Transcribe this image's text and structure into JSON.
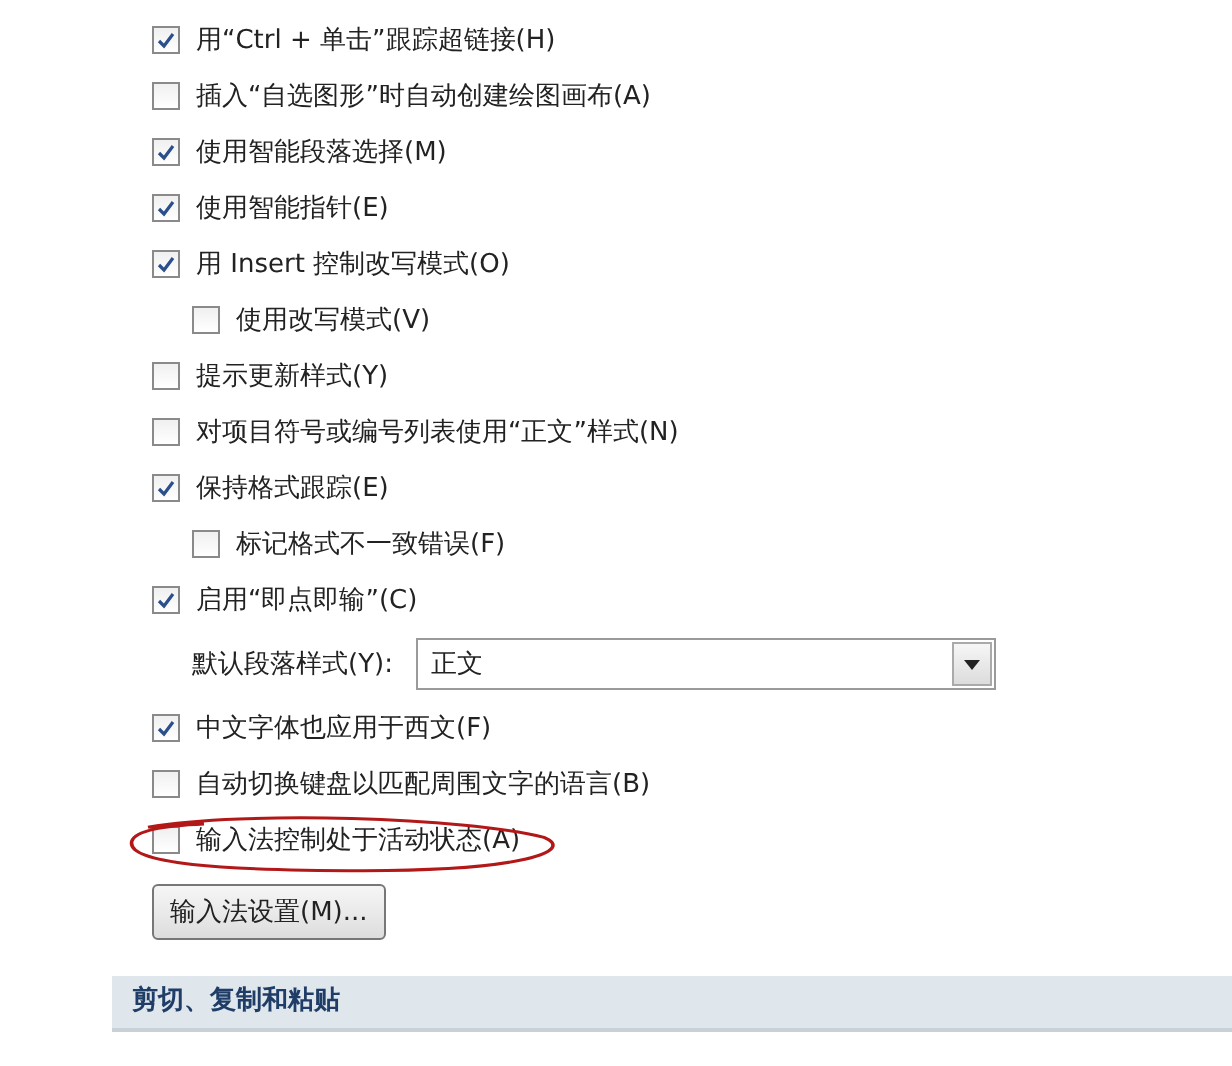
{
  "options": [
    {
      "kind": "checkbox",
      "label": "用“Ctrl + 单击”跟踪超链接(H)",
      "checked": true
    },
    {
      "kind": "checkbox",
      "label": "插入“自选图形”时自动创建绘图画布(A)",
      "checked": false
    },
    {
      "kind": "checkbox",
      "label": "使用智能段落选择(M)",
      "checked": true
    },
    {
      "kind": "checkbox",
      "label": "使用智能指针(E)",
      "checked": true
    },
    {
      "kind": "checkbox",
      "label": "用 Insert 控制改写模式(O)",
      "checked": true,
      "children": [
        {
          "kind": "checkbox",
          "label": "使用改写模式(V)",
          "checked": false
        }
      ]
    },
    {
      "kind": "checkbox",
      "label": "提示更新样式(Y)",
      "checked": false
    },
    {
      "kind": "checkbox",
      "label": "对项目符号或编号列表使用“正文”样式(N)",
      "checked": false
    },
    {
      "kind": "checkbox",
      "label": "保持格式跟踪(E)",
      "checked": true,
      "children": [
        {
          "kind": "checkbox",
          "label": "标记格式不一致错误(F)",
          "checked": false
        }
      ]
    },
    {
      "kind": "checkbox",
      "label": "启用“即点即输”(C)",
      "checked": true,
      "children": [
        {
          "kind": "dropdown",
          "label": "默认段落样式(Y):",
          "value": "正文"
        }
      ]
    },
    {
      "kind": "checkbox",
      "label": "中文字体也应用于西文(F)",
      "checked": true
    },
    {
      "kind": "checkbox",
      "label": "自动切换键盘以匹配周围文字的语言(B)",
      "checked": false
    },
    {
      "kind": "checkbox",
      "label": "输入法控制处于活动状态(A)",
      "checked": false,
      "circled": true
    },
    {
      "kind": "button",
      "label": "输入法设置(M)..."
    }
  ],
  "section_header": "剪切、复制和粘贴"
}
